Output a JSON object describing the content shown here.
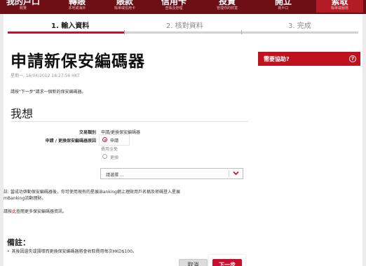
{
  "nav": {
    "items": [
      {
        "label": "我的戶口",
        "sub": "概覽"
      },
      {
        "label": "轉賬",
        "sub": "本地或海外"
      },
      {
        "label": "賬款",
        "sub": "賬單或信用卡"
      },
      {
        "label": "信用卡",
        "sub": "查賬及管理"
      },
      {
        "label": "投資",
        "sub": "管理你的財富"
      },
      {
        "label": "開立",
        "sub": "新戶口"
      },
      {
        "label": "索取",
        "sub": "賬單或服務"
      }
    ]
  },
  "steps": [
    {
      "label": "1. 輸入資料"
    },
    {
      "label": "2. 核對資料"
    },
    {
      "label": "3. 完成"
    }
  ],
  "page": {
    "title": "申請新保安編碼器",
    "timestamp": "星期一, 16/04/2012 18:27:56 HKT",
    "instruction": "請按\"下一步\"請求一個新的保安編碼器。"
  },
  "help": {
    "label": "需要協助?",
    "icon": "help-circle-icon"
  },
  "form": {
    "heading": "我想",
    "transaction_type_label": "交易類別",
    "transaction_type_value": "申請/更換保安編碼器",
    "reason_label": "申請 / 更換保安編碼器原因",
    "option_apply": "申請",
    "fee_note": "費用全免",
    "option_replace": "更換",
    "select_placeholder": "請選擇 ..."
  },
  "notes": {
    "note1_line1": "註: 當成功啓動保安編碼器後，你可使用現有的星展iBanking網上理財用戶名稱及密碼登入星展",
    "note1_line2": "mBanking流動理財。",
    "note2_prefix": "請按",
    "note2_link": "此",
    "note2_suffix": "查閱更多保安編碼器資訊。"
  },
  "remarks": {
    "title": "備註：",
    "item": "其後因遺失或損壞而更換保安編碼器將會收取費用每次HKD$100。"
  },
  "buttons": {
    "cancel": "取消",
    "next": "下一步"
  },
  "colors": {
    "brand_red": "#c8102e",
    "nav_dark": "#6e0f16",
    "nav_active": "#b31b25"
  }
}
